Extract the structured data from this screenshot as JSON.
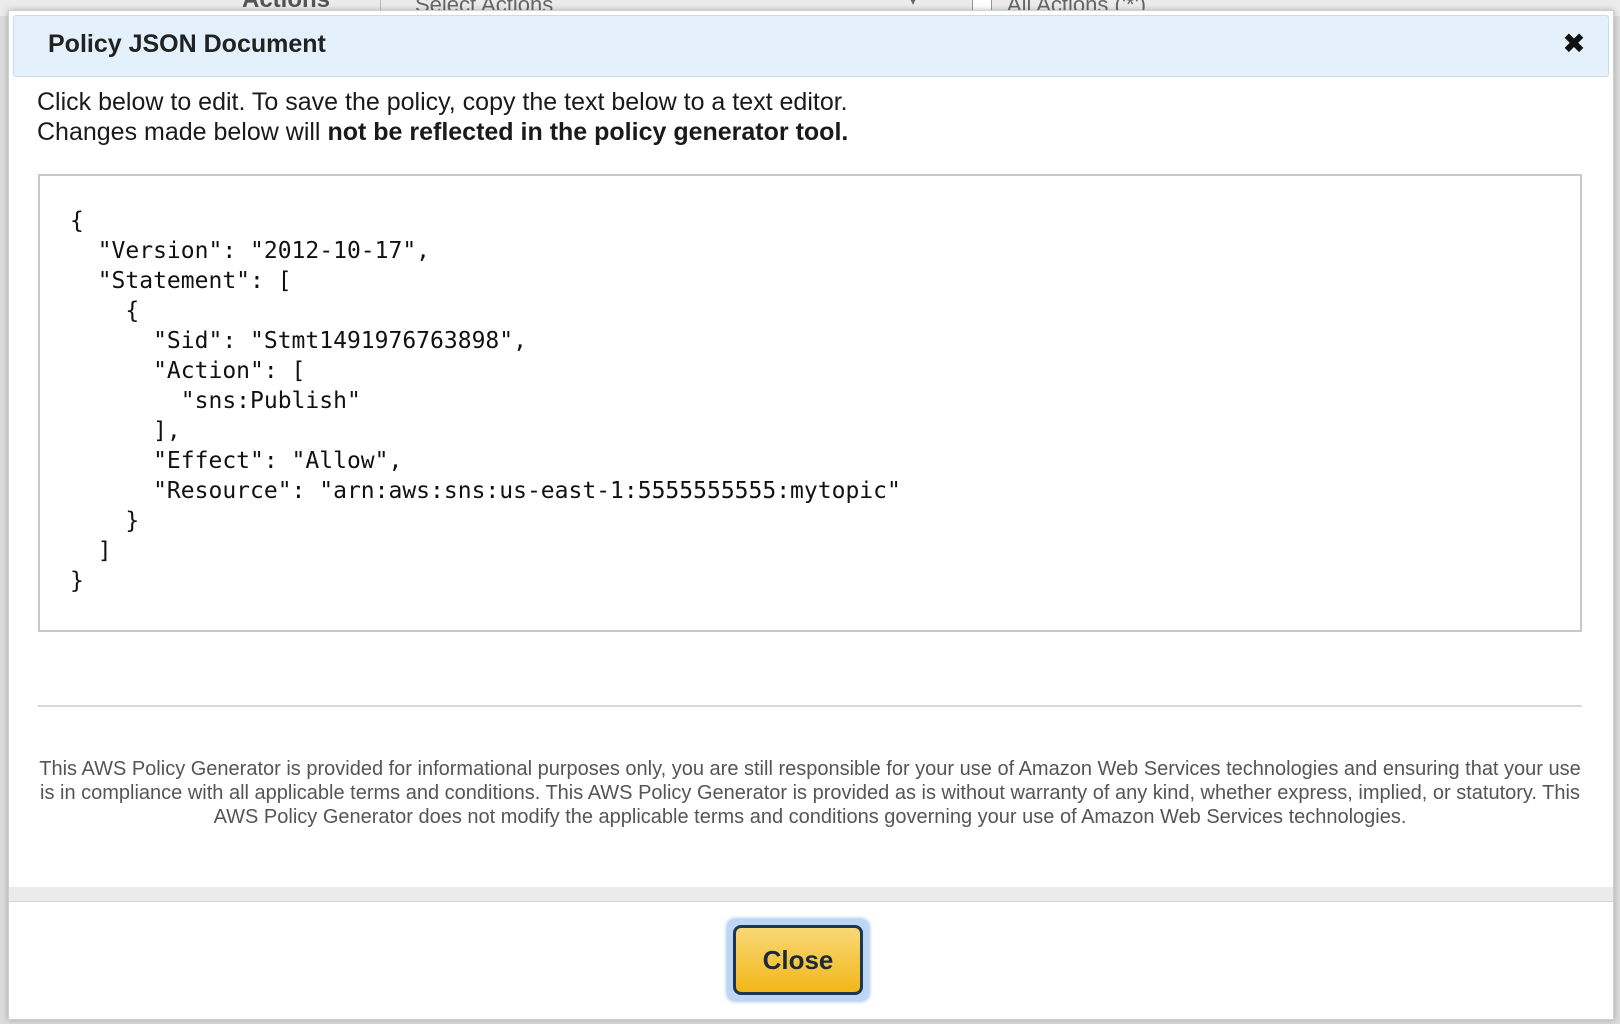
{
  "background": {
    "actions_label": "Actions",
    "select_placeholder": "Select Actions",
    "all_actions_label": "All Actions ('*')"
  },
  "modal": {
    "title": "Policy JSON Document",
    "close_icon": "close-icon",
    "intro_line1": "Click below to edit. To save the policy, copy the text below to a text editor.",
    "intro_line2_plain": "Changes made below will ",
    "intro_line2_bold": "not be reflected in the policy generator tool.",
    "policy_json": "{\n  \"Version\": \"2012-10-17\",\n  \"Statement\": [\n    {\n      \"Sid\": \"Stmt1491976763898\",\n      \"Action\": [\n        \"sns:Publish\"\n      ],\n      \"Effect\": \"Allow\",\n      \"Resource\": \"arn:aws:sns:us-east-1:5555555555:mytopic\"\n    }\n  ]\n}",
    "disclaimer": "This AWS Policy Generator is provided for informational purposes only, you are still responsible for your use of Amazon Web Services technologies and ensuring that your use is in compliance with all applicable terms and conditions. This AWS Policy Generator is provided as is without warranty of any kind, whether express, implied, or statutory. This AWS Policy Generator does not modify the applicable terms and conditions governing your use of Amazon Web Services technologies.",
    "close_button_label": "Close"
  },
  "colors": {
    "header_bg": "#e4f0fb",
    "button_gold": "#f2b71a",
    "button_border": "#1f3550"
  }
}
